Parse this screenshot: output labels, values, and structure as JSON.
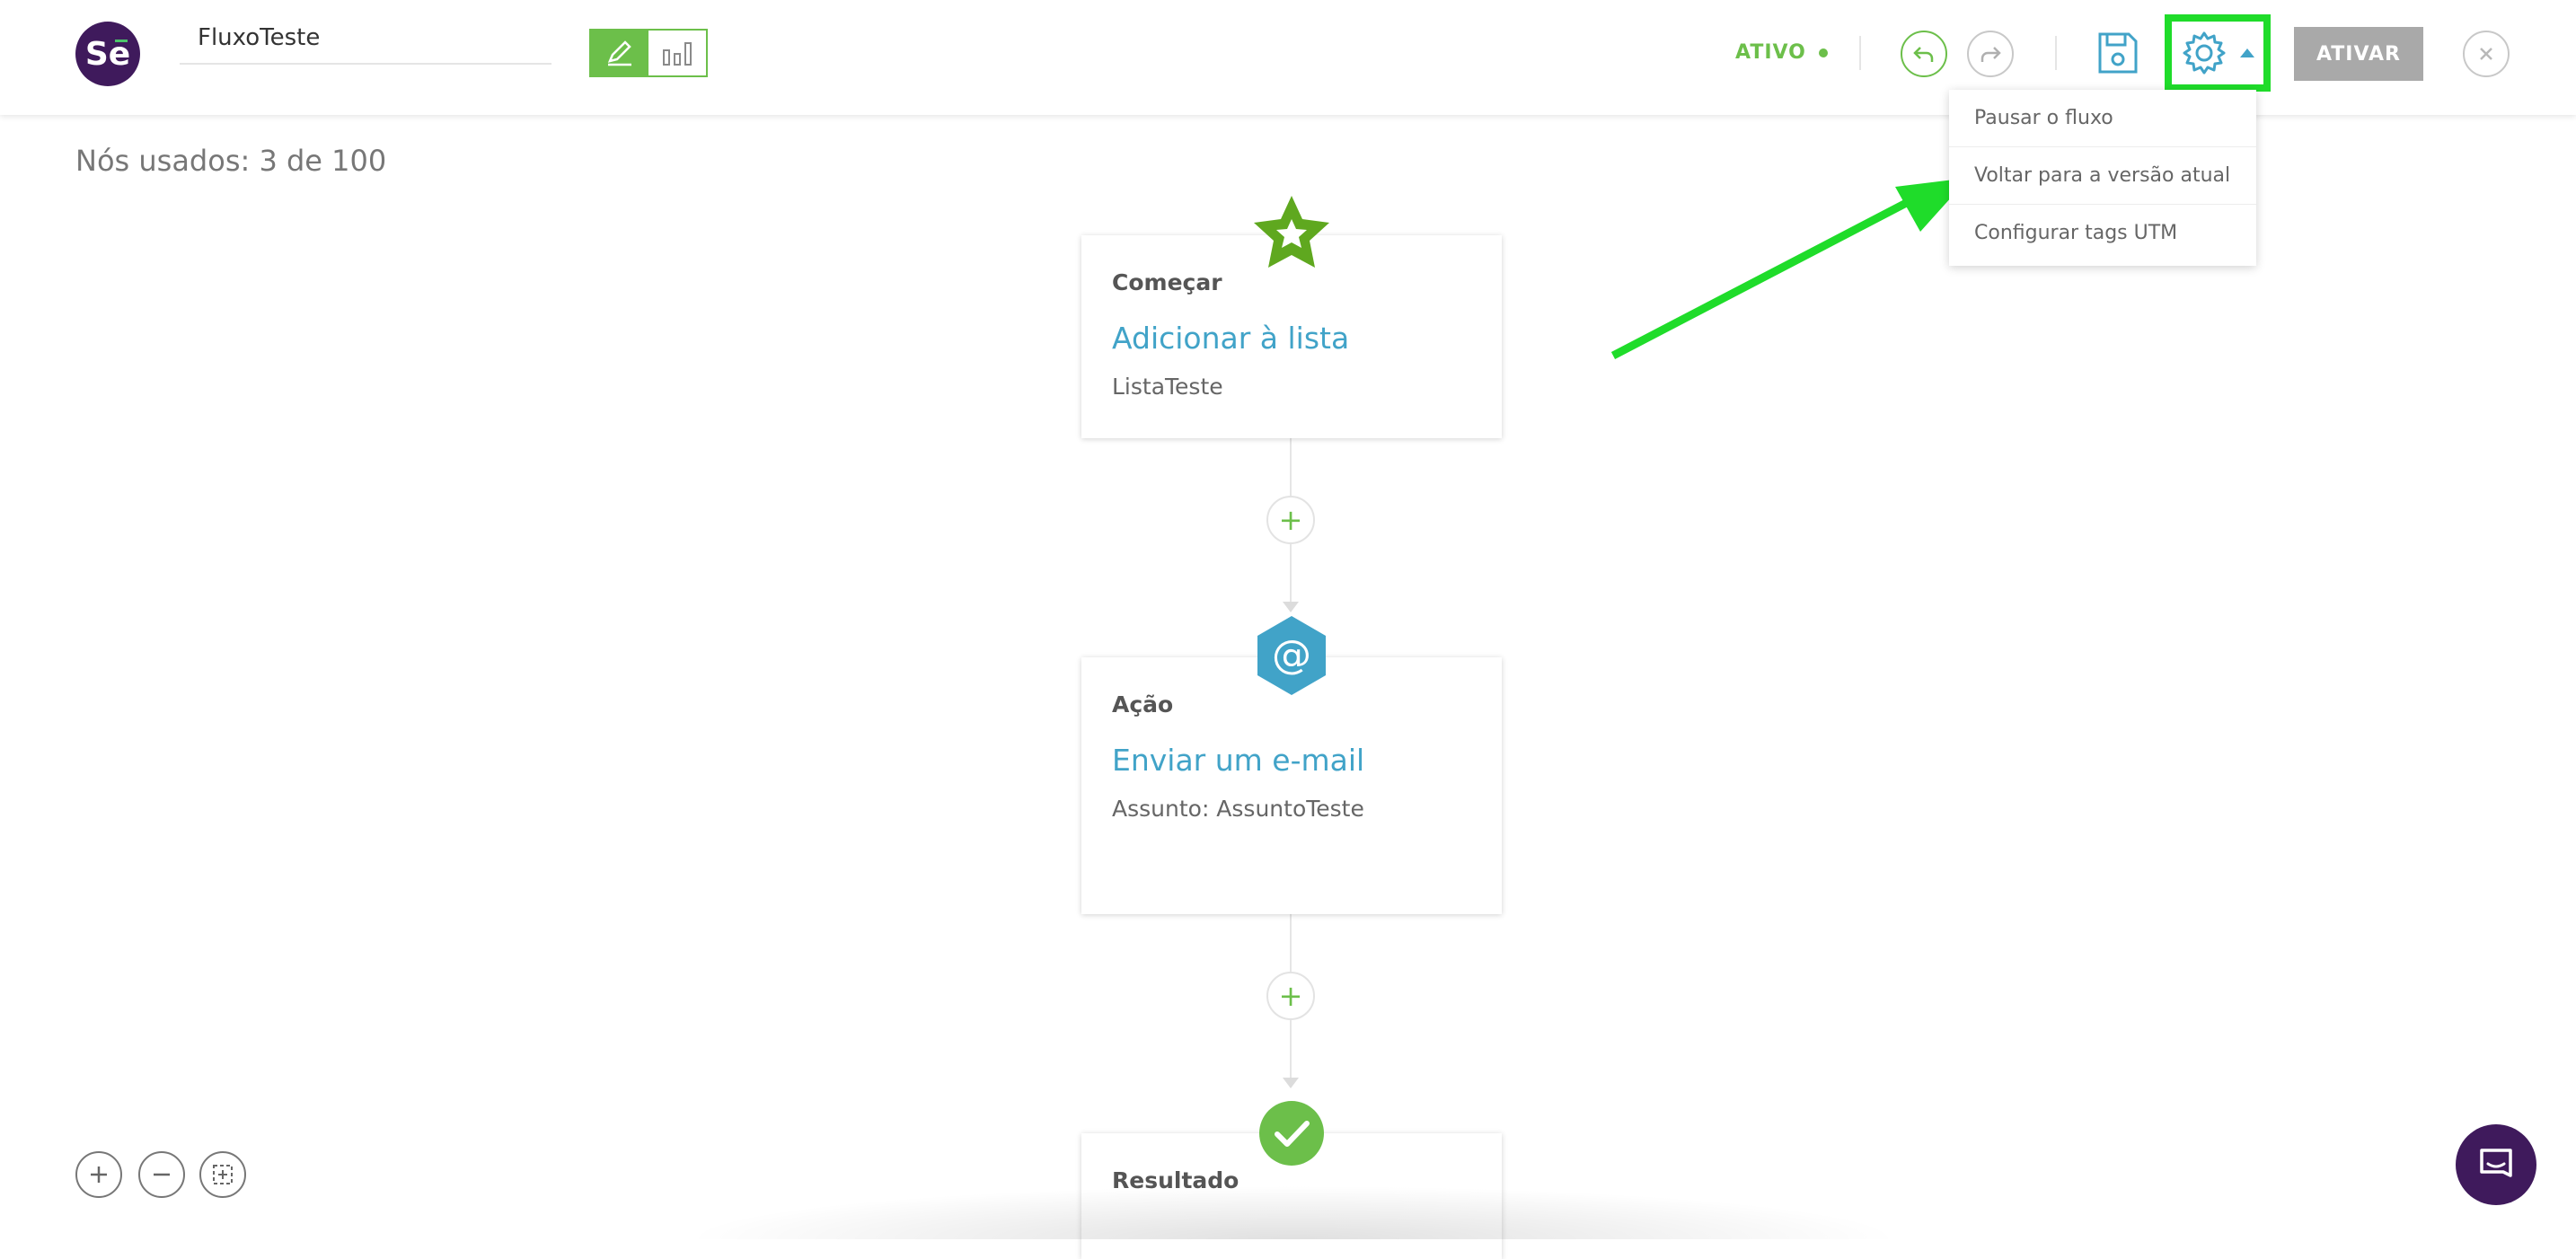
{
  "app": {
    "logo_text": "Se",
    "flow_name": "FluxoTeste",
    "status": "ATIVO",
    "activate_label": "ATIVAR"
  },
  "settings_menu": {
    "items": [
      {
        "label": "Pausar o fluxo"
      },
      {
        "label": "Voltar para a versão atual"
      },
      {
        "label": "Configurar tags UTM"
      }
    ]
  },
  "canvas": {
    "nodes_used": "Nós usados: 3 de 100",
    "nodes": [
      {
        "type": "Começar",
        "title": "Adicionar à lista",
        "subtitle": "ListaTeste",
        "icon": "star-icon"
      },
      {
        "type": "Ação",
        "title": "Enviar um e-mail",
        "subtitle": "Assunto: AssuntoTeste",
        "icon": "at-sign-icon"
      },
      {
        "type": "Resultado",
        "title": "",
        "subtitle": "",
        "icon": "check-icon"
      }
    ],
    "add_symbol": "+"
  },
  "colors": {
    "brand_purple": "#3f1a5c",
    "accent_green": "#6cbf4a",
    "link_blue": "#41a3c8",
    "highlight_green": "#1fdc2a"
  }
}
